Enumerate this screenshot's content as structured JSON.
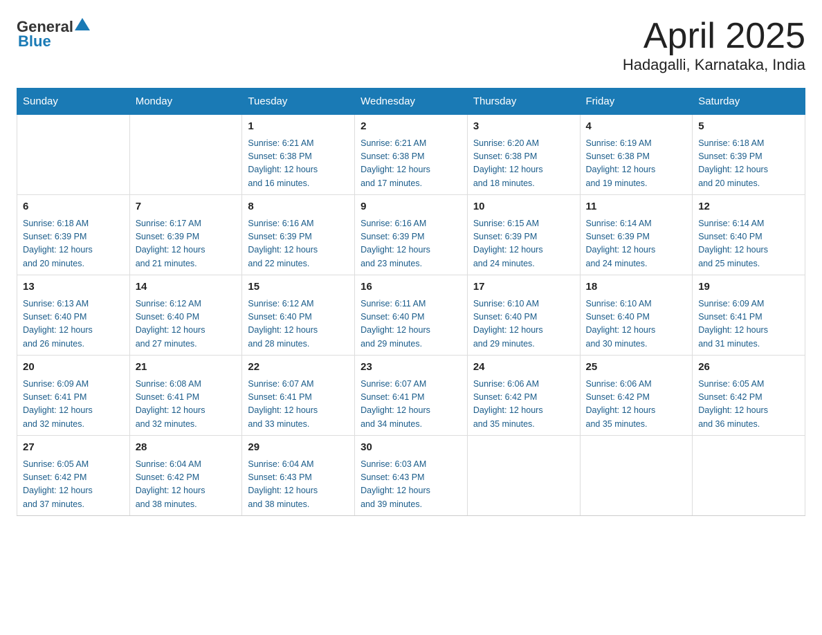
{
  "logo": {
    "general": "General",
    "blue": "Blue"
  },
  "header": {
    "month": "April 2025",
    "location": "Hadagalli, Karnataka, India"
  },
  "weekdays": [
    "Sunday",
    "Monday",
    "Tuesday",
    "Wednesday",
    "Thursday",
    "Friday",
    "Saturday"
  ],
  "weeks": [
    [
      {
        "day": "",
        "info": ""
      },
      {
        "day": "",
        "info": ""
      },
      {
        "day": "1",
        "info": "Sunrise: 6:21 AM\nSunset: 6:38 PM\nDaylight: 12 hours\nand 16 minutes."
      },
      {
        "day": "2",
        "info": "Sunrise: 6:21 AM\nSunset: 6:38 PM\nDaylight: 12 hours\nand 17 minutes."
      },
      {
        "day": "3",
        "info": "Sunrise: 6:20 AM\nSunset: 6:38 PM\nDaylight: 12 hours\nand 18 minutes."
      },
      {
        "day": "4",
        "info": "Sunrise: 6:19 AM\nSunset: 6:38 PM\nDaylight: 12 hours\nand 19 minutes."
      },
      {
        "day": "5",
        "info": "Sunrise: 6:18 AM\nSunset: 6:39 PM\nDaylight: 12 hours\nand 20 minutes."
      }
    ],
    [
      {
        "day": "6",
        "info": "Sunrise: 6:18 AM\nSunset: 6:39 PM\nDaylight: 12 hours\nand 20 minutes."
      },
      {
        "day": "7",
        "info": "Sunrise: 6:17 AM\nSunset: 6:39 PM\nDaylight: 12 hours\nand 21 minutes."
      },
      {
        "day": "8",
        "info": "Sunrise: 6:16 AM\nSunset: 6:39 PM\nDaylight: 12 hours\nand 22 minutes."
      },
      {
        "day": "9",
        "info": "Sunrise: 6:16 AM\nSunset: 6:39 PM\nDaylight: 12 hours\nand 23 minutes."
      },
      {
        "day": "10",
        "info": "Sunrise: 6:15 AM\nSunset: 6:39 PM\nDaylight: 12 hours\nand 24 minutes."
      },
      {
        "day": "11",
        "info": "Sunrise: 6:14 AM\nSunset: 6:39 PM\nDaylight: 12 hours\nand 24 minutes."
      },
      {
        "day": "12",
        "info": "Sunrise: 6:14 AM\nSunset: 6:40 PM\nDaylight: 12 hours\nand 25 minutes."
      }
    ],
    [
      {
        "day": "13",
        "info": "Sunrise: 6:13 AM\nSunset: 6:40 PM\nDaylight: 12 hours\nand 26 minutes."
      },
      {
        "day": "14",
        "info": "Sunrise: 6:12 AM\nSunset: 6:40 PM\nDaylight: 12 hours\nand 27 minutes."
      },
      {
        "day": "15",
        "info": "Sunrise: 6:12 AM\nSunset: 6:40 PM\nDaylight: 12 hours\nand 28 minutes."
      },
      {
        "day": "16",
        "info": "Sunrise: 6:11 AM\nSunset: 6:40 PM\nDaylight: 12 hours\nand 29 minutes."
      },
      {
        "day": "17",
        "info": "Sunrise: 6:10 AM\nSunset: 6:40 PM\nDaylight: 12 hours\nand 29 minutes."
      },
      {
        "day": "18",
        "info": "Sunrise: 6:10 AM\nSunset: 6:40 PM\nDaylight: 12 hours\nand 30 minutes."
      },
      {
        "day": "19",
        "info": "Sunrise: 6:09 AM\nSunset: 6:41 PM\nDaylight: 12 hours\nand 31 minutes."
      }
    ],
    [
      {
        "day": "20",
        "info": "Sunrise: 6:09 AM\nSunset: 6:41 PM\nDaylight: 12 hours\nand 32 minutes."
      },
      {
        "day": "21",
        "info": "Sunrise: 6:08 AM\nSunset: 6:41 PM\nDaylight: 12 hours\nand 32 minutes."
      },
      {
        "day": "22",
        "info": "Sunrise: 6:07 AM\nSunset: 6:41 PM\nDaylight: 12 hours\nand 33 minutes."
      },
      {
        "day": "23",
        "info": "Sunrise: 6:07 AM\nSunset: 6:41 PM\nDaylight: 12 hours\nand 34 minutes."
      },
      {
        "day": "24",
        "info": "Sunrise: 6:06 AM\nSunset: 6:42 PM\nDaylight: 12 hours\nand 35 minutes."
      },
      {
        "day": "25",
        "info": "Sunrise: 6:06 AM\nSunset: 6:42 PM\nDaylight: 12 hours\nand 35 minutes."
      },
      {
        "day": "26",
        "info": "Sunrise: 6:05 AM\nSunset: 6:42 PM\nDaylight: 12 hours\nand 36 minutes."
      }
    ],
    [
      {
        "day": "27",
        "info": "Sunrise: 6:05 AM\nSunset: 6:42 PM\nDaylight: 12 hours\nand 37 minutes."
      },
      {
        "day": "28",
        "info": "Sunrise: 6:04 AM\nSunset: 6:42 PM\nDaylight: 12 hours\nand 38 minutes."
      },
      {
        "day": "29",
        "info": "Sunrise: 6:04 AM\nSunset: 6:43 PM\nDaylight: 12 hours\nand 38 minutes."
      },
      {
        "day": "30",
        "info": "Sunrise: 6:03 AM\nSunset: 6:43 PM\nDaylight: 12 hours\nand 39 minutes."
      },
      {
        "day": "",
        "info": ""
      },
      {
        "day": "",
        "info": ""
      },
      {
        "day": "",
        "info": ""
      }
    ]
  ]
}
